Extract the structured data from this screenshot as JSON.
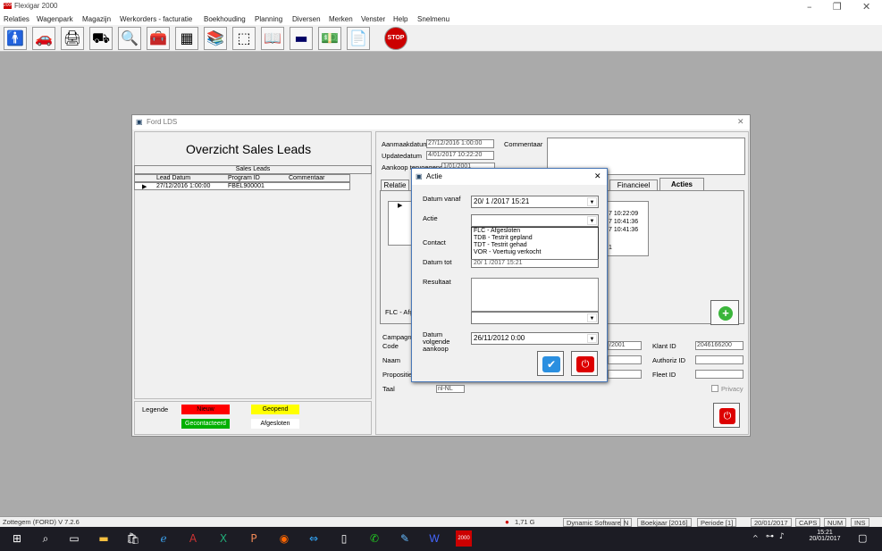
{
  "app": {
    "title": "Flexigar 2000",
    "icon_label": "2000"
  },
  "menu": [
    "Relaties",
    "Wagenpark",
    "Magazijn",
    "Werkorders - facturatie",
    "Boekhouding",
    "Planning",
    "Diversen",
    "Merken",
    "Venster",
    "Help",
    "Snelmenu"
  ],
  "toolbar_icons": [
    "person-icon",
    "car-icon",
    "printer-icon",
    "forklift-icon",
    "magnifier-icon",
    "toolbox-icon",
    "calculator-icon",
    "books-icon",
    "chart-icon",
    "book-icon",
    "screen-icon",
    "money-icon",
    "document-icon",
    "stop-icon"
  ],
  "toolbar_stop_label": "STOP",
  "window": {
    "title": "Ford LDS",
    "heading": "Overzicht Sales Leads",
    "grid_caption": "Sales Leads",
    "columns": [
      "Lead Datum",
      "Program ID",
      "Commentaar"
    ],
    "rows": [
      {
        "date": "27/12/2016 1:00:00",
        "program": "FBEL900001",
        "comment": ""
      }
    ],
    "aanmaak_label": "Aanmaakdatum",
    "aanmaak_value": "27/12/2016 1:00:00",
    "update_label": "Updatedatum",
    "update_value": "4/01/2017 10:22:20",
    "aankoop_label": "Aankoop tervoegend",
    "aankoop_value": "1/01/2001",
    "commentaar_label": "Commentaar",
    "tabs": [
      "Relatie",
      "Financieel",
      "Acties"
    ],
    "grid_times": [
      "7 10:22:09",
      "7 10:41:36",
      "7 10:41:36",
      "1"
    ],
    "flc_label": "FLC - Afg",
    "campagne_label": "Campagne",
    "code_label": "Code",
    "naam_label": "Naam",
    "propositie_label": "Propositie",
    "taal_label": "Taal",
    "taal_value": "nl-NL",
    "date_partial": "/2001",
    "klant_label": "Klant ID",
    "klant_value": "2046166200",
    "authoriz_label": "Authoriz ID",
    "fleet_label": "Fleet ID",
    "privacy_label": "Privacy",
    "legend_label": "Legende",
    "legend": [
      {
        "label": "Nieuw",
        "color": "#ff0000"
      },
      {
        "label": "Geopend",
        "color": "#ffff00"
      },
      {
        "label": "Gecontacteerd",
        "color": "#00b000"
      },
      {
        "label": "Afgesloten",
        "color": "#ffffff"
      }
    ]
  },
  "dialog": {
    "title": "Actie",
    "datum_vanaf_label": "Datum vanaf",
    "datum_vanaf_value": "20/ 1 /2017 15:21",
    "actie_label": "Actie",
    "actie_value": "",
    "actie_options": [
      "FLC - Afgesloten",
      "TDB - Testrit gepland",
      "TDT - Testrit gehad",
      "VOR - Voertuig verkocht"
    ],
    "contact_label": "Contact",
    "datum_tot_label": "Datum tot",
    "datum_tot_value": "20/ 1 /2017 15:21",
    "resultaat_label": "Resultaat",
    "volgende_label": "Datum volgende aankoop",
    "volgende_value": "26/11/2012 0:00"
  },
  "status": {
    "left": "Zottegem (FORD)  V 7.2.6",
    "disk": "1,71 G",
    "items": [
      "Dynamic Software",
      "N",
      "Boekjaar [2016]",
      "Periode [1]",
      "20/01/2017",
      "CAPS",
      "NUM",
      "INS"
    ]
  },
  "taskbar": {
    "time": "15:21",
    "date": "20/01/2017",
    "app_label": "2000"
  }
}
